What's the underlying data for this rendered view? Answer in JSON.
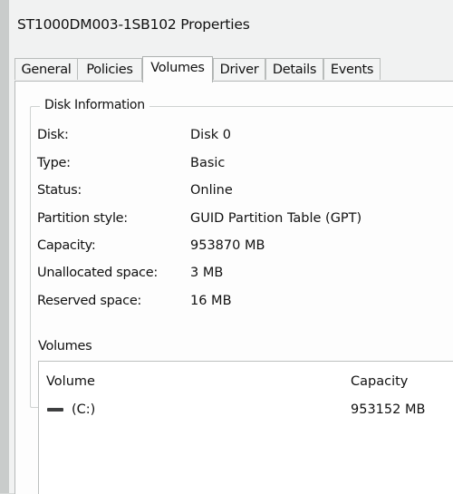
{
  "window": {
    "title": "ST1000DM003-1SB102 Properties"
  },
  "tabs": [
    {
      "label": "General"
    },
    {
      "label": "Policies"
    },
    {
      "label": "Volumes",
      "active": true
    },
    {
      "label": "Driver"
    },
    {
      "label": "Details"
    },
    {
      "label": "Events"
    }
  ],
  "disk_info": {
    "legend": "Disk Information",
    "rows": [
      {
        "label": "Disk:",
        "value": "Disk 0"
      },
      {
        "label": "Type:",
        "value": "Basic"
      },
      {
        "label": "Status:",
        "value": "Online"
      },
      {
        "label": "Partition style:",
        "value": "GUID Partition Table (GPT)"
      },
      {
        "label": "Capacity:",
        "value": "953870 MB"
      },
      {
        "label": "Unallocated space:",
        "value": "3 MB"
      },
      {
        "label": "Reserved space:",
        "value": "16 MB"
      }
    ]
  },
  "volumes": {
    "heading": "Volumes",
    "columns": {
      "volume": "Volume",
      "capacity": "Capacity"
    },
    "rows": [
      {
        "volume": "(C:)",
        "capacity": "953152 MB",
        "icon": "drive-icon"
      }
    ]
  }
}
